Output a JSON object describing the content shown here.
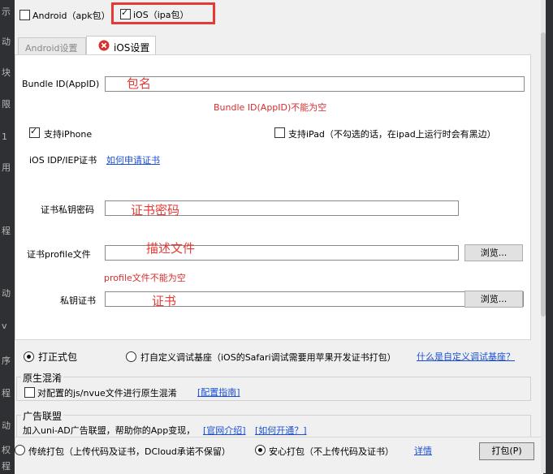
{
  "left_strip": [
    "示",
    "动",
    "块",
    "限",
    "1",
    "用",
    "程",
    "动",
    "v",
    "序",
    "程",
    "动",
    "权",
    "程"
  ],
  "platforms": {
    "android": {
      "label": "Android（apk包）",
      "checked": false
    },
    "ios": {
      "label": "iOS（ipa包）",
      "checked": true
    }
  },
  "tabs": [
    {
      "label": "Android设置"
    },
    {
      "label": "iOS设置"
    }
  ],
  "ios": {
    "bundle_id_label": "Bundle ID(AppID)",
    "bundle_id_hint": "包名",
    "bundle_id_error": "Bundle ID(AppID)不能为空",
    "support_iphone": {
      "label": "支持iPhone",
      "checked": true
    },
    "support_ipad": {
      "label": "支持iPad（不勾选的话，在ipad上运行时会有黑边）",
      "checked": false
    },
    "cert_type_label": "iOS IDP/IEP证书",
    "apply_cert_link": "如何申请证书",
    "cert_password_label": "证书私钥密码",
    "cert_password_hint": "证书密码",
    "profile_label": "证书profile文件",
    "profile_hint": "描述文件",
    "profile_error": "profile文件不能为空",
    "private_key_label": "私钥证书",
    "private_key_hint": "证书",
    "browse_label": "浏览..."
  },
  "build_type": {
    "formal": {
      "label": "打正式包",
      "selected": true
    },
    "custom": {
      "label": "打自定义调试基座（iOS的Safari调试需要用苹果开发证书打包）",
      "selected": false
    },
    "custom_link": "什么是自定义调试基座？"
  },
  "native_obfuscation": {
    "title": "原生混淆",
    "option": {
      "label": "对配置的js/nvue文件进行原生混淆",
      "checked": false
    },
    "guide_link": "[配置指南]"
  },
  "ad_alliance": {
    "title": "广告联盟",
    "text": "加入uni-AD广告联盟，帮助你的App变现，",
    "link1": "[官网介绍]",
    "link2": "[如何开通？]"
  },
  "bottom": {
    "traditional": {
      "label": "传统打包（上传代码及证书，DCloud承诺不保留）",
      "selected": false
    },
    "safe": {
      "label": "安心打包（不上传代码及证书）",
      "selected": true
    },
    "details_link": "详情",
    "pack_button": "打包(P)"
  }
}
